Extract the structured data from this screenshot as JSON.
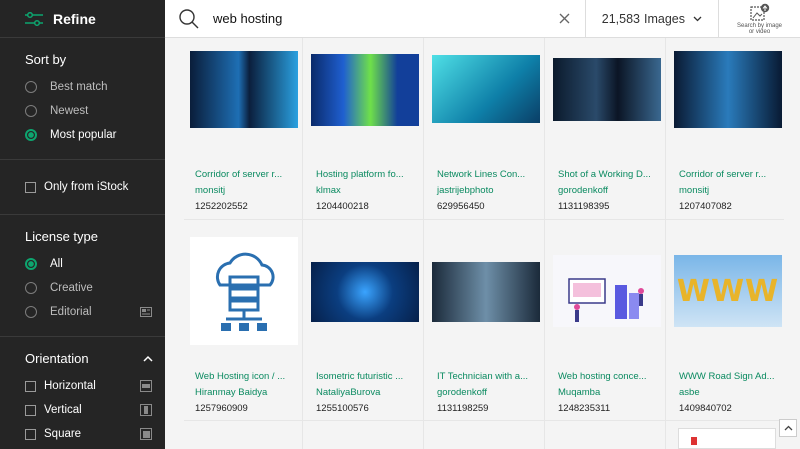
{
  "sidebar": {
    "refine_label": "Refine",
    "sort": {
      "title": "Sort by",
      "options": [
        {
          "label": "Best match",
          "selected": false
        },
        {
          "label": "Newest",
          "selected": false
        },
        {
          "label": "Most popular",
          "selected": true
        }
      ]
    },
    "istock_label": "Only from iStock",
    "license": {
      "title": "License type",
      "options": [
        {
          "label": "All",
          "selected": true
        },
        {
          "label": "Creative",
          "selected": false
        },
        {
          "label": "Editorial",
          "selected": false
        }
      ]
    },
    "orientation": {
      "title": "Orientation",
      "options": [
        {
          "label": "Horizontal"
        },
        {
          "label": "Vertical"
        },
        {
          "label": "Square"
        }
      ]
    }
  },
  "search": {
    "query": "web hosting"
  },
  "results": {
    "count": "21,583",
    "type_label": "Images"
  },
  "image_search": {
    "label_line1": "Search by image",
    "label_line2": "or video"
  },
  "colors": {
    "accent": "#0da56f",
    "link": "#0a8a60",
    "sidebar_bg": "#252525"
  },
  "cards": [
    {
      "title": "Corridor of server r...",
      "author": "monsitj",
      "id": "1252202552",
      "icon": "server-corridor-image"
    },
    {
      "title": "Hosting platform fo...",
      "author": "klmax",
      "id": "1204400218",
      "icon": "server-rack-image"
    },
    {
      "title": "Network Lines Con...",
      "author": "jastrijebphoto",
      "id": "629956450",
      "icon": "network-lines-image"
    },
    {
      "title": "Shot of a Working D...",
      "author": "gorodenkoff",
      "id": "1131198395",
      "icon": "data-center-image"
    },
    {
      "title": "Corridor of server r...",
      "author": "monsitj",
      "id": "1207407082",
      "icon": "server-globe-image"
    },
    {
      "title": "Web Hosting icon / ...",
      "author": "Hiranmay Baidya",
      "id": "1257960909",
      "icon": "cloud-server-icon-image"
    },
    {
      "title": "Isometric futuristic ...",
      "author": "NataliyaBurova",
      "id": "1255100576",
      "icon": "isometric-server-image"
    },
    {
      "title": "IT Technician with a...",
      "author": "gorodenkoff",
      "id": "1131198259",
      "icon": "technician-image"
    },
    {
      "title": "Web hosting conce...",
      "author": "Muqamba",
      "id": "1248235311",
      "icon": "hosting-concept-image"
    },
    {
      "title": "WWW Road Sign Ad...",
      "author": "asbe",
      "id": "1409840702",
      "icon": "www-sign-image"
    }
  ]
}
